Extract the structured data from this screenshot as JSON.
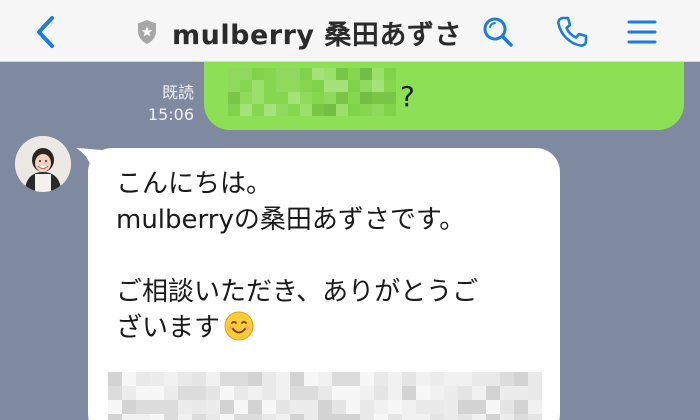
{
  "header": {
    "title": "mulberry 桑田あずさ",
    "accent_color": "#1a7ce0",
    "icons": [
      "back-chevron-icon",
      "shield-icon",
      "search-icon",
      "phone-icon",
      "menu-icon"
    ]
  },
  "messages": {
    "outgoing": {
      "text_visible": "?",
      "read_label": "既読",
      "time": "15:06",
      "bubble_color": "#8de055",
      "content_blurred": true
    },
    "incoming": {
      "text": "こんにちは。\nmulberryの桑田あずさです。\n\nご相談いただき、ありがとうご\nざいます",
      "emoji": "smiling-face-icon",
      "bubble_color": "#ffffff",
      "content_blurred": true
    }
  }
}
